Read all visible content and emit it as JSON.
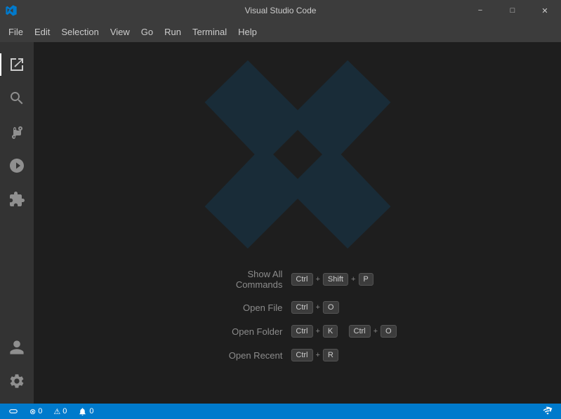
{
  "titlebar": {
    "title": "Visual Studio Code",
    "minimize_label": "−",
    "maximize_label": "□",
    "close_label": "✕"
  },
  "menubar": {
    "items": [
      "File",
      "Edit",
      "Selection",
      "View",
      "Go",
      "Run",
      "Terminal",
      "Help"
    ]
  },
  "activity": {
    "icons": [
      {
        "name": "explorer-icon",
        "label": "Explorer",
        "active": true
      },
      {
        "name": "search-icon",
        "label": "Search"
      },
      {
        "name": "source-control-icon",
        "label": "Source Control"
      },
      {
        "name": "run-icon",
        "label": "Run and Debug"
      },
      {
        "name": "extensions-icon",
        "label": "Extensions"
      }
    ]
  },
  "shortcuts": [
    {
      "label": "Show All\nCommands",
      "keys": [
        "Ctrl",
        "+",
        "Shift",
        "+",
        "P"
      ]
    },
    {
      "label": "Open File",
      "keys": [
        "Ctrl",
        "+",
        "O"
      ]
    },
    {
      "label": "Open Folder",
      "keys_group1": [
        "Ctrl",
        "+",
        "K"
      ],
      "keys_group2": [
        "Ctrl",
        "+",
        "O"
      ]
    },
    {
      "label": "Open Recent",
      "keys": [
        "Ctrl",
        "+",
        "R"
      ]
    }
  ],
  "statusbar": {
    "left_items": [
      {
        "icon": "remote-icon",
        "text": ""
      },
      {
        "icon": "error-icon",
        "text": "⊗ 0"
      },
      {
        "icon": "warning-icon",
        "text": "⚠ 0"
      },
      {
        "icon": "notification-icon",
        "text": "🔔 0"
      }
    ],
    "right_items": [
      {
        "icon": "broadcast-icon",
        "text": ""
      }
    ]
  }
}
